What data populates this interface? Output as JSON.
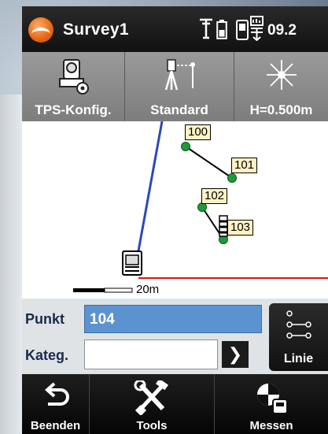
{
  "titlebar": {
    "title": "Survey1",
    "time": "09.2",
    "icons": [
      "survey-logo-icon",
      "antenna-icon",
      "battery-icon",
      "device-status-icon"
    ]
  },
  "toolbar": {
    "buttons": [
      {
        "label": "TPS-Konfig.",
        "icon": "total-station-config-icon"
      },
      {
        "label": "Standard",
        "icon": "measure-mode-icon"
      },
      {
        "label": "H=0.500m",
        "icon": "prism-target-icon"
      }
    ]
  },
  "map": {
    "points": [
      {
        "label": "100"
      },
      {
        "label": "101"
      },
      {
        "label": "102"
      },
      {
        "label": "103"
      }
    ],
    "scale": "20m",
    "colors": {
      "line_of_sight": "#2b49b8",
      "point": "#1e9a3a",
      "baseline": "#e01010",
      "label_bg": "#fff3c4"
    }
  },
  "form": {
    "punkt_label": "Punkt",
    "punkt_value": "104",
    "kateg_label": "Kateg.",
    "kateg_value": "",
    "linie_label": "Linie"
  },
  "bottombar": {
    "buttons": [
      {
        "label": "Beenden",
        "icon": "exit-arrow-icon"
      },
      {
        "label": "Tools",
        "icon": "tools-icon"
      },
      {
        "label": "Messen",
        "icon": "measure-icon"
      }
    ]
  }
}
